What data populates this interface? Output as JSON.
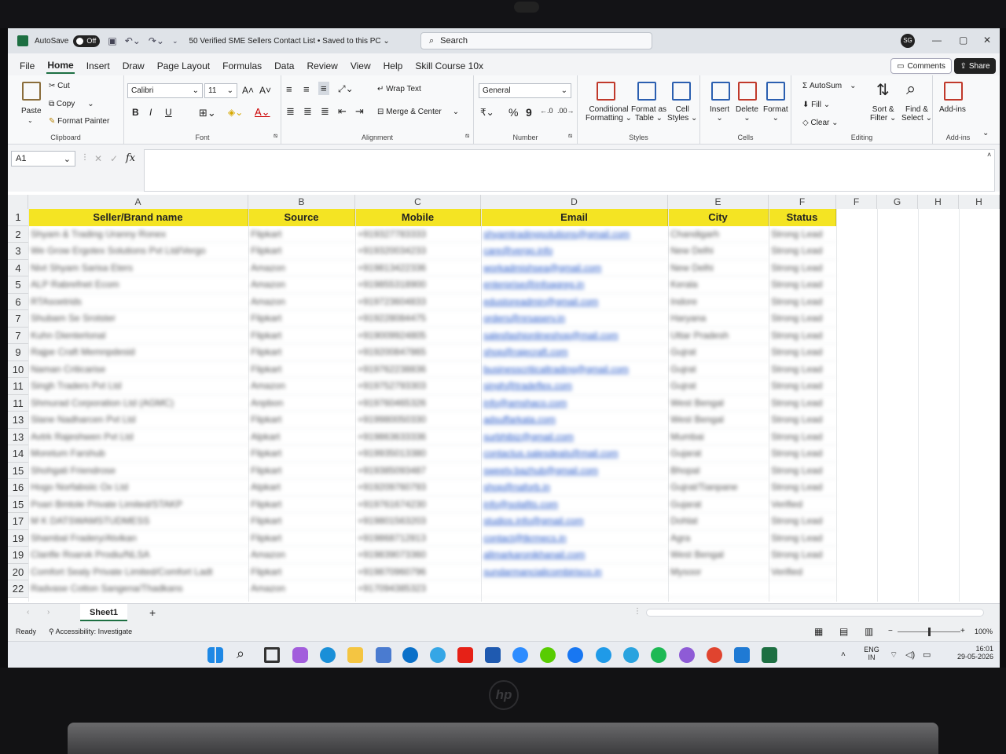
{
  "window": {
    "autosave_label": "AutoSave",
    "autosave_state": "Off",
    "doc_title": "50 Verified SME Sellers Contact List  •  Saved to this PC  ⌄",
    "search_placeholder": "Search",
    "avatar": "SG"
  },
  "menu": [
    "File",
    "Home",
    "Insert",
    "Draw",
    "Page Layout",
    "Formulas",
    "Data",
    "Review",
    "View",
    "Help",
    "Skill Course 10x"
  ],
  "menu_active": "Home",
  "buttons": {
    "comments": "Comments",
    "share": "Share"
  },
  "ribbon": {
    "clipboard": {
      "paste": "Paste",
      "cut": "Cut",
      "copy": "Copy",
      "format_painter": "Format Painter",
      "label": "Clipboard"
    },
    "font": {
      "name": "Calibri",
      "size": "11",
      "label": "Font",
      "bold": "B",
      "italic": "I",
      "underline": "U"
    },
    "alignment": {
      "wrap": "Wrap Text",
      "merge": "Merge & Center",
      "label": "Alignment"
    },
    "number": {
      "format": "General",
      "percent": "%",
      "comma": "9",
      "label": "Number"
    },
    "styles": {
      "conditional": "Conditional",
      "conditional2": "Formatting ⌄",
      "format_table": "Format as",
      "format_table2": "Table ⌄",
      "cell_styles": "Cell",
      "cell_styles2": "Styles ⌄",
      "label": "Styles"
    },
    "cells": {
      "insert": "Insert",
      "delete": "Delete",
      "format": "Format",
      "label": "Cells"
    },
    "editing": {
      "autosum": "AutoSum",
      "fill": "Fill ⌄",
      "clear": "Clear ⌄",
      "sort": "Sort &",
      "sort2": "Filter ⌄",
      "find": "Find &",
      "find2": "Select ⌄",
      "label": "Editing"
    },
    "addins": {
      "addins": "Add-ins",
      "label": "Add-ins"
    }
  },
  "formula_bar": {
    "name_box": "A1",
    "fx": "fx"
  },
  "columns": [
    "A",
    "B",
    "C",
    "D",
    "E",
    "F",
    "F",
    "G",
    "H",
    "H"
  ],
  "header_row": [
    "Seller/Brand name",
    "Source",
    "Mobile",
    "Email",
    "City",
    "Status"
  ],
  "row_numbers": [
    "1",
    "2",
    "3",
    "4",
    "5",
    "6",
    "7",
    "7",
    "9",
    "10",
    "11",
    "11",
    "13",
    "13",
    "14",
    "15",
    "16",
    "15",
    "17",
    "19",
    "19",
    "20",
    "22"
  ],
  "rows": [
    [
      "Shyam & Trading Uranny Ronex",
      "Flipkart",
      "+919327783333",
      "shyamtradingsolutions@gmail.com",
      "Chandigarh",
      "Strong Lead"
    ],
    [
      "We Grow Ergotex Solutions Pvt Ltd/Vergo",
      "Flipkart",
      "+919320034233",
      "care@vergo.info",
      "New Delhi",
      "Strong Lead"
    ],
    [
      "Nivt Shyam Sarisa Eters",
      "Amazon",
      "+919813422336",
      "workadmishsea@gmail.com",
      "New Delhi",
      "Strong Lead"
    ],
    [
      "ALP Rabrefnet Ecom",
      "Amazon",
      "+919855318900",
      "enterprise@infoagreg.in",
      "Kerala",
      "Strong Lead"
    ],
    [
      "RTAsoetrids",
      "Amazon",
      "+919723604833",
      "edustoreadmin@gmail.com",
      "Indore",
      "Strong Lead"
    ],
    [
      "Shubam Se Srotster",
      "Flipkart",
      "+919228084475",
      "orders@nrsaserv.in",
      "Haryana",
      "Strong Lead"
    ],
    [
      "Kuhn Dienterlonal",
      "Flipkart",
      "+919009924805",
      "salesfashionlineshop@mail.com",
      "Uttar Pradesh",
      "Strong Lead"
    ],
    [
      "Rajpe Craft Memnpdesid",
      "Flipkart",
      "+919200847865",
      "shop@rajecraft.com",
      "Gujrat",
      "Strong Lead"
    ],
    [
      "Naman Criticarise",
      "Flipkart",
      "+919762238836",
      "businesscriticaltrading@gmail.com",
      "Gujrat",
      "Strong Lead"
    ],
    [
      "Singh Traders Pvt Ltd",
      "Amazon",
      "+919752793303",
      "singh@tradeflex.com",
      "Gujrat",
      "Strong Lead"
    ],
    [
      "Shmurad Corporation Ltd (AGMC)",
      "Anpbon",
      "+919760465326",
      "info@amshaco.com",
      "West Bengal",
      "Strong Lead"
    ],
    [
      "Slane Nadharcen Pvt Ltd",
      "Flipkart",
      "+919980050330",
      "adsuffarkata.com",
      "West Bengal",
      "Strong Lead"
    ],
    [
      "Avtrk Rajeshwen Pvt Ltd",
      "Alpkart",
      "+919863633336",
      "surbhibiz@gmail.com",
      "Mumbai",
      "Strong Lead"
    ],
    [
      "Moretum Farshub",
      "Flipkart",
      "+919935013380",
      "contactus.salesdeals@mail.com",
      "Gujarat",
      "Strong Lead"
    ],
    [
      "Shohgati Friendrose",
      "Flipkart",
      "+919385093487",
      "sweety.bazhub@gmail.com",
      "Bhopal",
      "Strong Lead"
    ],
    [
      "Hogo Norfabsiic Ox Ltd",
      "Atpkart",
      "+919209760793",
      "shop@naforb.in",
      "Gujrat/Tianpane",
      "Strong Lead"
    ],
    [
      "Poari Bmtole Private Limited/STAKP",
      "Flipkart",
      "+919761674230",
      "info@solafits.com",
      "Gujarat",
      "Verified"
    ],
    [
      "M K DATSWAMSTUDMESS",
      "Flipkart",
      "+919801563203",
      "studios.info@gmail.com",
      "Dohlat",
      "Strong Lead"
    ],
    [
      "Shambal Fradery/Atvikan",
      "Flipkart",
      "+919868712813",
      "contact@tkrmecs.in",
      "Agra",
      "Strong Lead"
    ],
    [
      "Clanfle Roarvk Prodiu/NLSA",
      "Amazon",
      "+919839073360",
      "allmarkaronikhanail.com",
      "West Bengal",
      "Strong Lead"
    ],
    [
      "Comfort Sealy Private Limited/Comfort Ladt",
      "Flipkart",
      "+919870960796",
      "sundarmancialicombirisco.in",
      "Mysoor",
      "Verified"
    ],
    [
      "Radvase Cotton Sangena/Thadkans",
      "Amazon",
      "+917094385323",
      "",
      "",
      ""
    ]
  ],
  "sheet_tab": "Sheet1",
  "status": {
    "ready": "Ready",
    "accessibility": "Accessibility: Investigate",
    "zoom": "100%"
  },
  "tray": {
    "lang1": "ENG",
    "lang2": "IN",
    "time": "16:01",
    "date": "29-05-2026"
  },
  "colors": {
    "excel_green": "#1d6f42",
    "header_yellow": "#f4e423"
  }
}
